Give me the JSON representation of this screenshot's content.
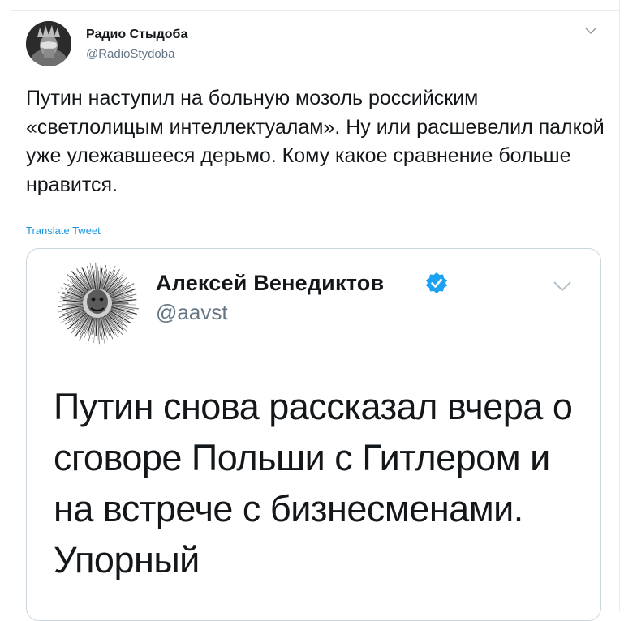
{
  "tweet": {
    "author_name": "Радио Стыдоба",
    "author_handle": "@RadioStydoba",
    "avatar_icon": "statue-of-liberty-facepalm-avatar",
    "text": "Путин наступил на больную мозоль российским «светлолицым интеллектуалам». Ну или расшевелил палкой уже улежавшееся дерьмо. Кому какое сравнение больше нравится.",
    "translate_label": "Translate Tweet",
    "menu_icon": "chevron-down-icon"
  },
  "quoted_tweet": {
    "author_name": "Алексей Венедиктов",
    "author_handle": "@aavst",
    "verified": true,
    "text": "Путин снова рассказал вчера о сговоре Польши с Гитлером и на встрече с бизнесменами. Упорный",
    "avatar_icon": "fuzzy-radial-portrait-avatar",
    "menu_icon": "chevron-down-icon"
  },
  "colors": {
    "text_primary": "#14171a",
    "text_secondary": "#657786",
    "link": "#1b95e0",
    "verified_badge": "#1da1f2",
    "border": "#ccd6dd"
  }
}
